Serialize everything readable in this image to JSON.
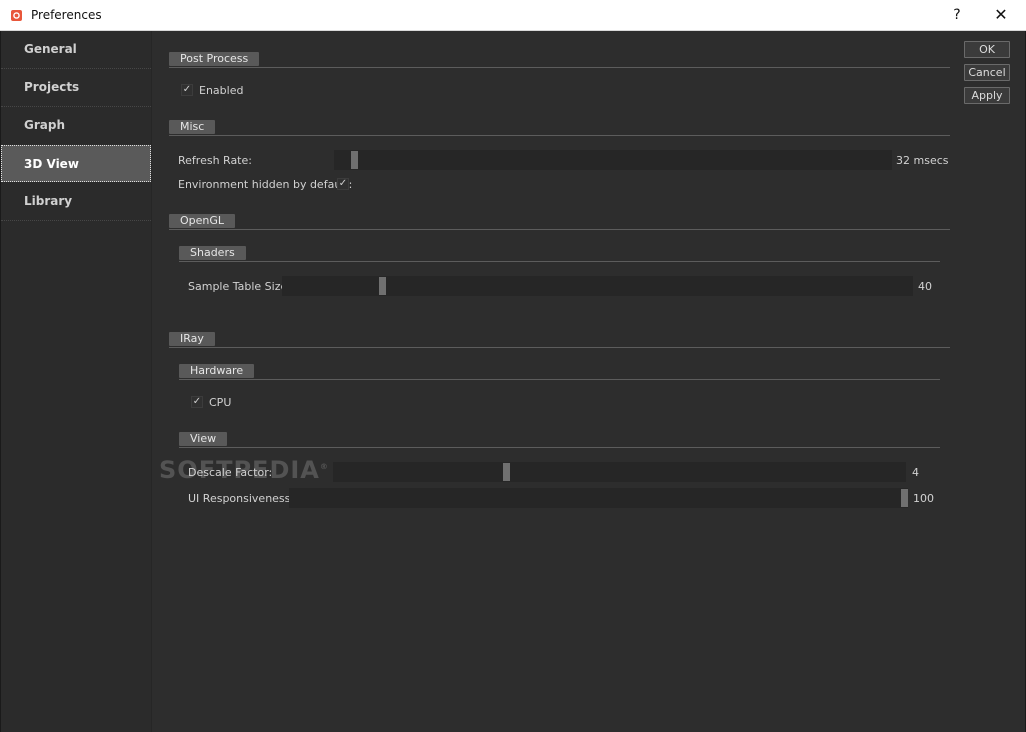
{
  "window": {
    "title": "Preferences",
    "help_label": "?",
    "close_label": "✕"
  },
  "sidebar": {
    "items": [
      {
        "label": "General",
        "active": false
      },
      {
        "label": "Projects",
        "active": false
      },
      {
        "label": "Graph",
        "active": false
      },
      {
        "label": "3D View",
        "active": true
      },
      {
        "label": "Library",
        "active": false
      }
    ]
  },
  "sections": {
    "post_process": {
      "title": "Post Process",
      "enabled_label": "Enabled",
      "enabled_checked": true
    },
    "misc": {
      "title": "Misc",
      "refresh_rate_label": "Refresh Rate:",
      "refresh_rate_value": "32 msecs",
      "refresh_rate_fraction": 0.03,
      "env_hidden_label": "Environment hidden by default:",
      "env_hidden_checked": true
    },
    "opengl": {
      "title": "OpenGL",
      "shaders": {
        "title": "Shaders",
        "sample_table_label": "Sample Table Size:",
        "sample_table_value": "40",
        "sample_table_fraction": 0.155
      }
    },
    "iray": {
      "title": "IRay",
      "hardware": {
        "title": "Hardware",
        "cpu_label": "CPU",
        "cpu_checked": true
      },
      "view": {
        "title": "View",
        "descale_label": "Descale Factor:",
        "descale_value": "4",
        "descale_fraction": 0.3,
        "ui_resp_label": "UI Responsiveness:",
        "ui_resp_value": "100",
        "ui_resp_fraction": 1.0
      }
    }
  },
  "buttons": {
    "ok": "OK",
    "cancel": "Cancel",
    "apply": "Apply"
  },
  "watermark": "SOFTPEDIA",
  "check_glyph": "✓"
}
